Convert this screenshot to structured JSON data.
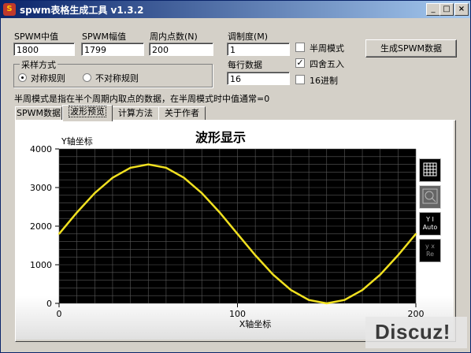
{
  "window": {
    "title": "spwm表格生成工具 v1.3.2",
    "icon_text": "S",
    "minimize_icon": "_",
    "maximize_icon": "□",
    "close_icon": "×"
  },
  "fields": {
    "center_label": "SPWM中值",
    "center_value": "1800",
    "amplitude_label": "SPWM幅值",
    "amplitude_value": "1799",
    "points_label": "周内点数(N)",
    "points_value": "200",
    "modulation_label": "调制度(M)",
    "modulation_value": "1",
    "per_row_label": "每行数据",
    "per_row_value": "16"
  },
  "sampling": {
    "group_title": "采样方式",
    "options": [
      "对称规则",
      "不对称规则"
    ],
    "selected": 0
  },
  "options": {
    "half_cycle": {
      "label": "半周模式",
      "checked": false
    },
    "round": {
      "label": "四舍五入",
      "checked": true
    },
    "hex": {
      "label": "16进制",
      "checked": false
    },
    "check_mark": "✓"
  },
  "generate_button": "生成SPWM数据",
  "hint": "半周模式是指在半个周期内取点的数据，在半周模式时中值通常=0",
  "tabs": [
    {
      "label": "SPWM数据",
      "active": false
    },
    {
      "label": "波形预览",
      "active": true
    },
    {
      "label": "计算方法",
      "active": false
    },
    {
      "label": "关于作者",
      "active": false
    }
  ],
  "side_buttons": {
    "grid": "",
    "zoom": "",
    "y_auto_top": "Y   I",
    "y_auto_bottom": "Auto",
    "reset_top": "y   x",
    "reset_bottom": "Re"
  },
  "watermark": "Discuz!",
  "chart_data": {
    "type": "line",
    "title": "波形显示",
    "xlabel": "X轴坐标",
    "ylabel": "Y轴坐标",
    "xlim": [
      0,
      200
    ],
    "ylim": [
      0,
      4000
    ],
    "x_ticks": [
      0,
      100,
      200
    ],
    "y_ticks": [
      0,
      1000,
      2000,
      3000,
      4000
    ],
    "grid": true,
    "background": "#000000",
    "grid_color": "#5a5a5a",
    "line_color": "#f0e020",
    "series": [
      {
        "name": "",
        "x": [
          0,
          10,
          20,
          30,
          40,
          50,
          60,
          70,
          80,
          90,
          100,
          110,
          120,
          130,
          140,
          150,
          160,
          170,
          180,
          190,
          200
        ],
        "values": [
          1800,
          2356,
          2857,
          3256,
          3512,
          3599,
          3512,
          3256,
          2857,
          2356,
          1800,
          1244,
          743,
          344,
          88,
          1,
          88,
          344,
          743,
          1244,
          1800
        ]
      }
    ]
  }
}
